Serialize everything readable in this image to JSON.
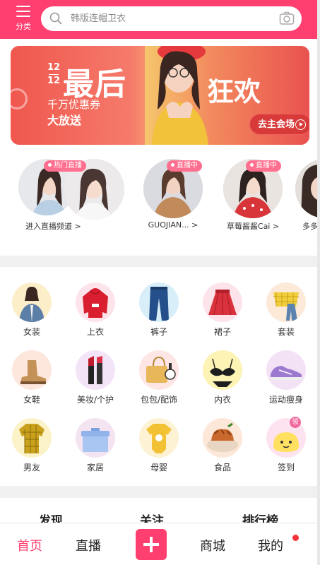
{
  "header": {
    "menu_label": "分类",
    "search_placeholder": "韩版连帽卫衣"
  },
  "banner": {
    "date_top": "12",
    "date_bottom": "12",
    "title": "最后",
    "title_right": "狂欢",
    "subtitle": "千万优惠券",
    "subtitle2": "大放送",
    "cta": "去主会场"
  },
  "live": {
    "items": [
      {
        "label": "进入直播频道 >",
        "badge": "热门直播"
      },
      {
        "label": "GUOJIAN... >",
        "badge": "直播中"
      },
      {
        "label": "草莓酱酱Cai >",
        "badge": "直播中"
      },
      {
        "label": "多多"
      }
    ]
  },
  "categories": [
    {
      "label": "女装",
      "icon": "jacket-icon",
      "color": "#fbeec9"
    },
    {
      "label": "上衣",
      "icon": "hoodie-icon",
      "color": "#fde3ea"
    },
    {
      "label": "裤子",
      "icon": "jeans-icon",
      "color": "#d8eef8"
    },
    {
      "label": "裙子",
      "icon": "skirt-icon",
      "color": "#fde3ea"
    },
    {
      "label": "套装",
      "icon": "plaid-top-icon",
      "color": "#fde9d8"
    },
    {
      "label": "女鞋",
      "icon": "boot-icon",
      "color": "#fde7dc"
    },
    {
      "label": "美妆/个护",
      "icon": "lipstick-icon",
      "color": "#f3e4f7"
    },
    {
      "label": "包包/配饰",
      "icon": "handbag-icon",
      "color": "#fde6e4"
    },
    {
      "label": "内衣",
      "icon": "lingerie-icon",
      "color": "#fcf3b4"
    },
    {
      "label": "运动瘦身",
      "icon": "sneaker-icon",
      "color": "#f3e1f6"
    },
    {
      "label": "男友",
      "icon": "shirt-icon",
      "color": "#fbf2c8"
    },
    {
      "label": "家居",
      "icon": "storage-box-icon",
      "color": "#f4e4f2"
    },
    {
      "label": "母婴",
      "icon": "baby-bodysuit-icon",
      "color": "#fdf2d4"
    },
    {
      "label": "食品",
      "icon": "food-icon",
      "color": "#fde7d9"
    },
    {
      "label": "签到",
      "icon": "checkin-icon",
      "color": "#fde3f0"
    }
  ],
  "checkin_badge": "领",
  "tabs": [
    "发现",
    "关注",
    "排行榜"
  ],
  "bottom_nav": {
    "home": "首页",
    "live": "直播",
    "mall": "商城",
    "mine": "我的"
  },
  "colors": {
    "brand": "#ff3f6f",
    "notify_dot": "#f4343a"
  }
}
